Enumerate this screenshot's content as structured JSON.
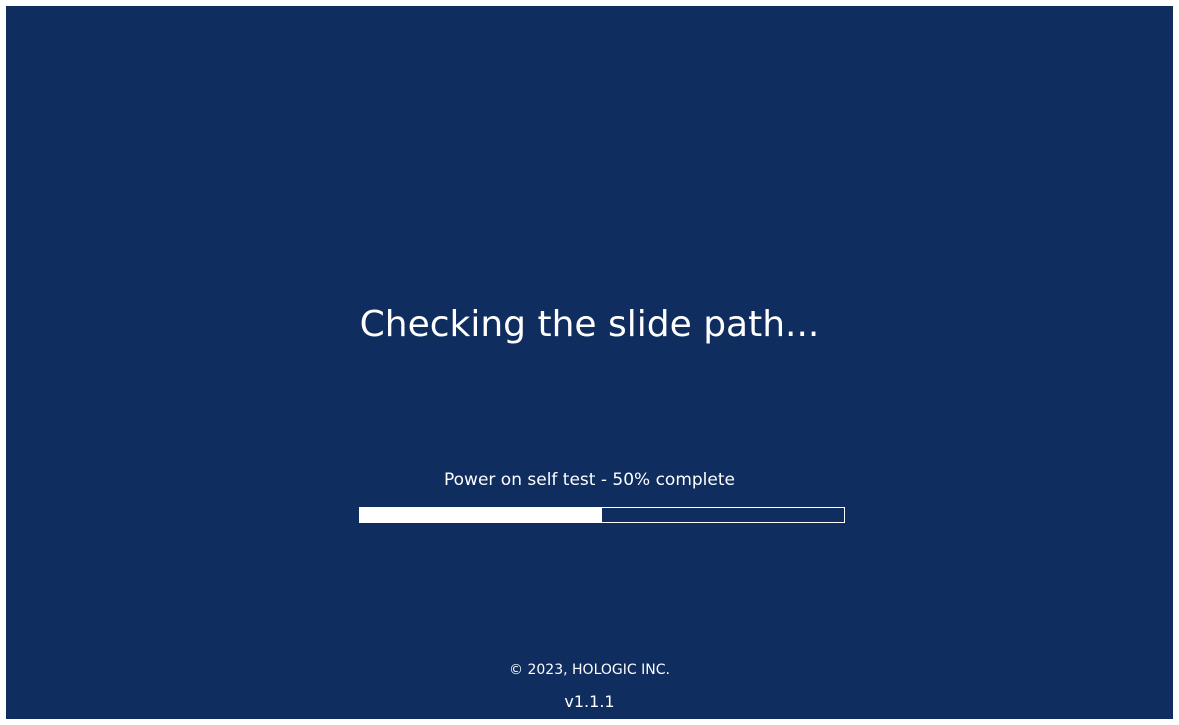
{
  "status": {
    "title": "Checking the slide path..."
  },
  "progress": {
    "label": "Power on self test - 50% complete",
    "percent": 50
  },
  "footer": {
    "copyright": "© 2023, HOLOGIC INC.",
    "version": "v1.1.1"
  },
  "colors": {
    "background": "#0f2d5f",
    "foreground": "#ffffff"
  }
}
